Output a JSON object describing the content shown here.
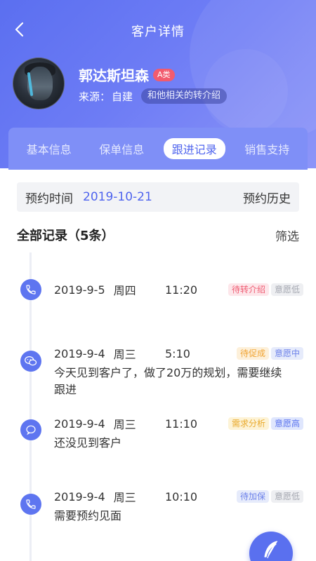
{
  "nav": {
    "title": "客户详情"
  },
  "profile": {
    "name": "郭达斯坦森",
    "level": "A类",
    "source_label": "来源：",
    "source_value": "自建",
    "relation": "和他相关的转介绍"
  },
  "tabs": [
    {
      "label": "基本信息",
      "active": false
    },
    {
      "label": "保单信息",
      "active": false
    },
    {
      "label": "跟进记录",
      "active": true
    },
    {
      "label": "销售支持",
      "active": false
    }
  ],
  "appointment": {
    "label": "预约时间",
    "date": "2019-10-21",
    "history": "预约历史"
  },
  "records_header": {
    "title": "全部记录（5条）",
    "filter": "筛选"
  },
  "records": [
    {
      "icon": "phone-icon",
      "date": "2019-9-5",
      "weekday": "周四",
      "time": "11:20",
      "tags": [
        "待转介绍",
        "意愿低"
      ],
      "note": ""
    },
    {
      "icon": "wechat-icon",
      "date": "2019-9-4",
      "weekday": "周三",
      "time": "5:10",
      "tags": [
        "待促成",
        "意愿中"
      ],
      "note": "今天见到客户了，做了20万的规划，需要继续跟进"
    },
    {
      "icon": "chat-icon",
      "date": "2019-9-4",
      "weekday": "周三",
      "time": "11:10",
      "tags": [
        "需求分析",
        "意愿高"
      ],
      "note": "还没见到客户"
    },
    {
      "icon": "phone-icon",
      "date": "2019-9-4",
      "weekday": "周三",
      "time": "10:10",
      "tags": [
        "待加保",
        "意愿低"
      ],
      "note": "需要预约见面"
    }
  ],
  "colors": {
    "primary": "#5b6ff0",
    "accent_text": "#4f64ee",
    "badge_red": "#f25b6e"
  },
  "fab": {
    "icon": "feather-pen-icon"
  }
}
